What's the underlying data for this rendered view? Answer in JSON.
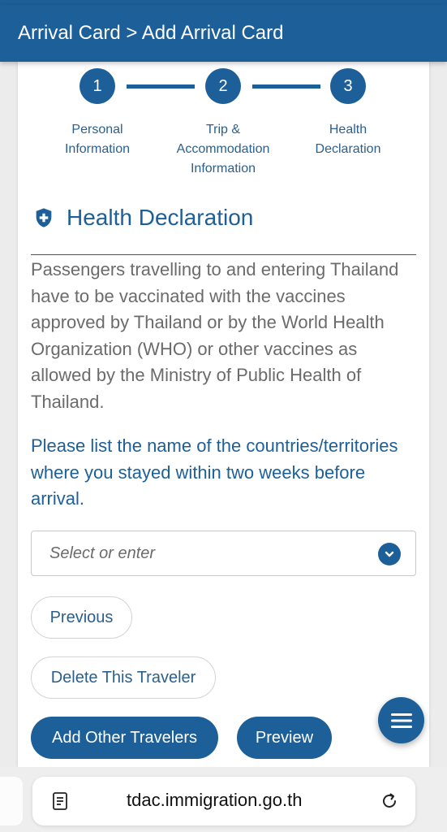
{
  "header": {
    "title": "Arrival Card > Add Arrival Card"
  },
  "steps": [
    {
      "number": "1",
      "label": "Personal Information"
    },
    {
      "number": "2",
      "label": "Trip & Accommodation Information"
    },
    {
      "number": "3",
      "label": "Health Declaration"
    }
  ],
  "section": {
    "title": "Health Declaration",
    "info": "Passengers travelling to and entering Thailand have to be vaccinated with the vaccines approved by Thailand or by the World Health Organization (WHO) or other vaccines as allowed by the Ministry of Public Health of Thailand.",
    "question": "Please list the name of the countries/territories where you stayed within two weeks before arrival."
  },
  "countries_select": {
    "placeholder": "Select or enter"
  },
  "buttons": {
    "previous": "Previous",
    "delete_traveler": "Delete This Traveler",
    "add_other_travelers": "Add Other Travelers",
    "preview": "Preview"
  },
  "browser": {
    "url": "tdac.immigration.go.th"
  },
  "colors": {
    "primary": "#1d5f98",
    "header_bg": "#1d5f98",
    "muted_text": "#6b6b6b"
  }
}
